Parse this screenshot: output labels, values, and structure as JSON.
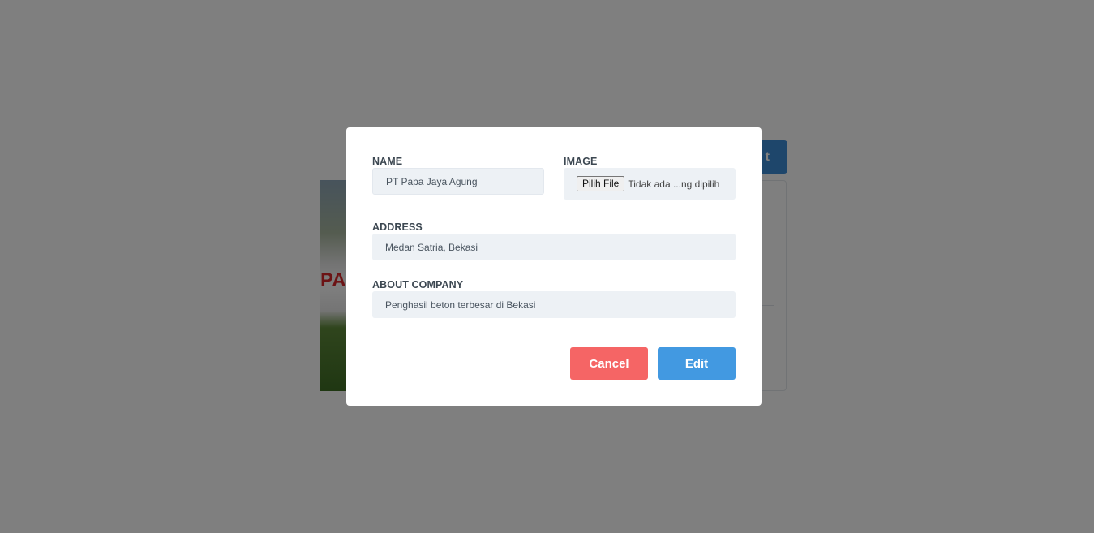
{
  "background": {
    "photo_text": "PAP",
    "button_label": "t"
  },
  "modal": {
    "name_label": "NAME",
    "name_value": "PT Papa Jaya Agung",
    "image_label": "IMAGE",
    "file_button_label": "Pilih File",
    "file_status": "Tidak ada ...ng dipilih",
    "address_label": "ADDRESS",
    "address_value": "Medan Satria, Bekasi",
    "about_label": "ABOUT COMPANY",
    "about_value": "Penghasil beton terbesar di Bekasi",
    "cancel_label": "Cancel",
    "edit_label": "Edit"
  },
  "colors": {
    "overlay": "#808080",
    "cancel": "#f56565",
    "edit": "#4299e1",
    "field_bg": "#edf1f5"
  }
}
